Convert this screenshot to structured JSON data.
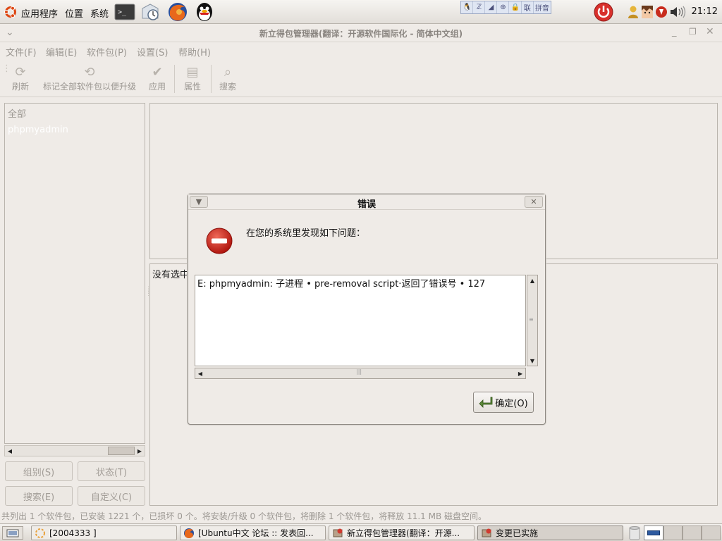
{
  "top_panel": {
    "menus": [
      "应用程序",
      "位置",
      "系统"
    ],
    "launchers": [
      "terminal-icon",
      "clock-icon",
      "firefox-icon",
      "qq-icon"
    ],
    "ime_bar": [
      "🐧",
      "ℤ",
      "◢",
      "⊕",
      "🔒",
      "联",
      "拼音"
    ],
    "clock": "21:12"
  },
  "window": {
    "title": "新立得包管理器(翻译：开源软件国际化 - 简体中文组)",
    "menubar": [
      "文件(F)",
      "编辑(E)",
      "软件包(P)",
      "设置(S)",
      "帮助(H)"
    ],
    "toolbar": {
      "refresh": "刷新",
      "mark_upgrades": "标记全部软件包以便升级",
      "apply": "应用",
      "properties": "属性",
      "search": "搜索"
    },
    "left_panel": {
      "header": "全部",
      "items": [
        "phpmyadmin"
      ]
    },
    "filter_buttons": {
      "sections": "组别(S)",
      "status": "状态(T)",
      "search": "搜索(E)",
      "custom": "自定义(C)"
    },
    "description_text": "没有选中",
    "statusbar": "共列出 1 个软件包，已安装 1221 个，已损坏 0 个。将安装/升级 0 个软件包，将删除 1 个软件包，将释放 11.1 MB 磁盘空间。"
  },
  "dialog": {
    "title": "错误",
    "message": "在您的系统里发现如下问题：",
    "error_text": "E: phpmyadmin: 子进程 • pre-removal script·返回了错误号 • 127",
    "ok_label": "确定(O)"
  },
  "taskbar": {
    "tasks": [
      "[2004333 ]",
      "[Ubuntu中文 论坛 :: 发表回...",
      "新立得包管理器(翻译：开源...",
      "变更已实施"
    ]
  },
  "colors": {
    "error_red": "#cc2a2a",
    "panel_bg": "#efebe7",
    "disabled_text": "#9c9893"
  }
}
